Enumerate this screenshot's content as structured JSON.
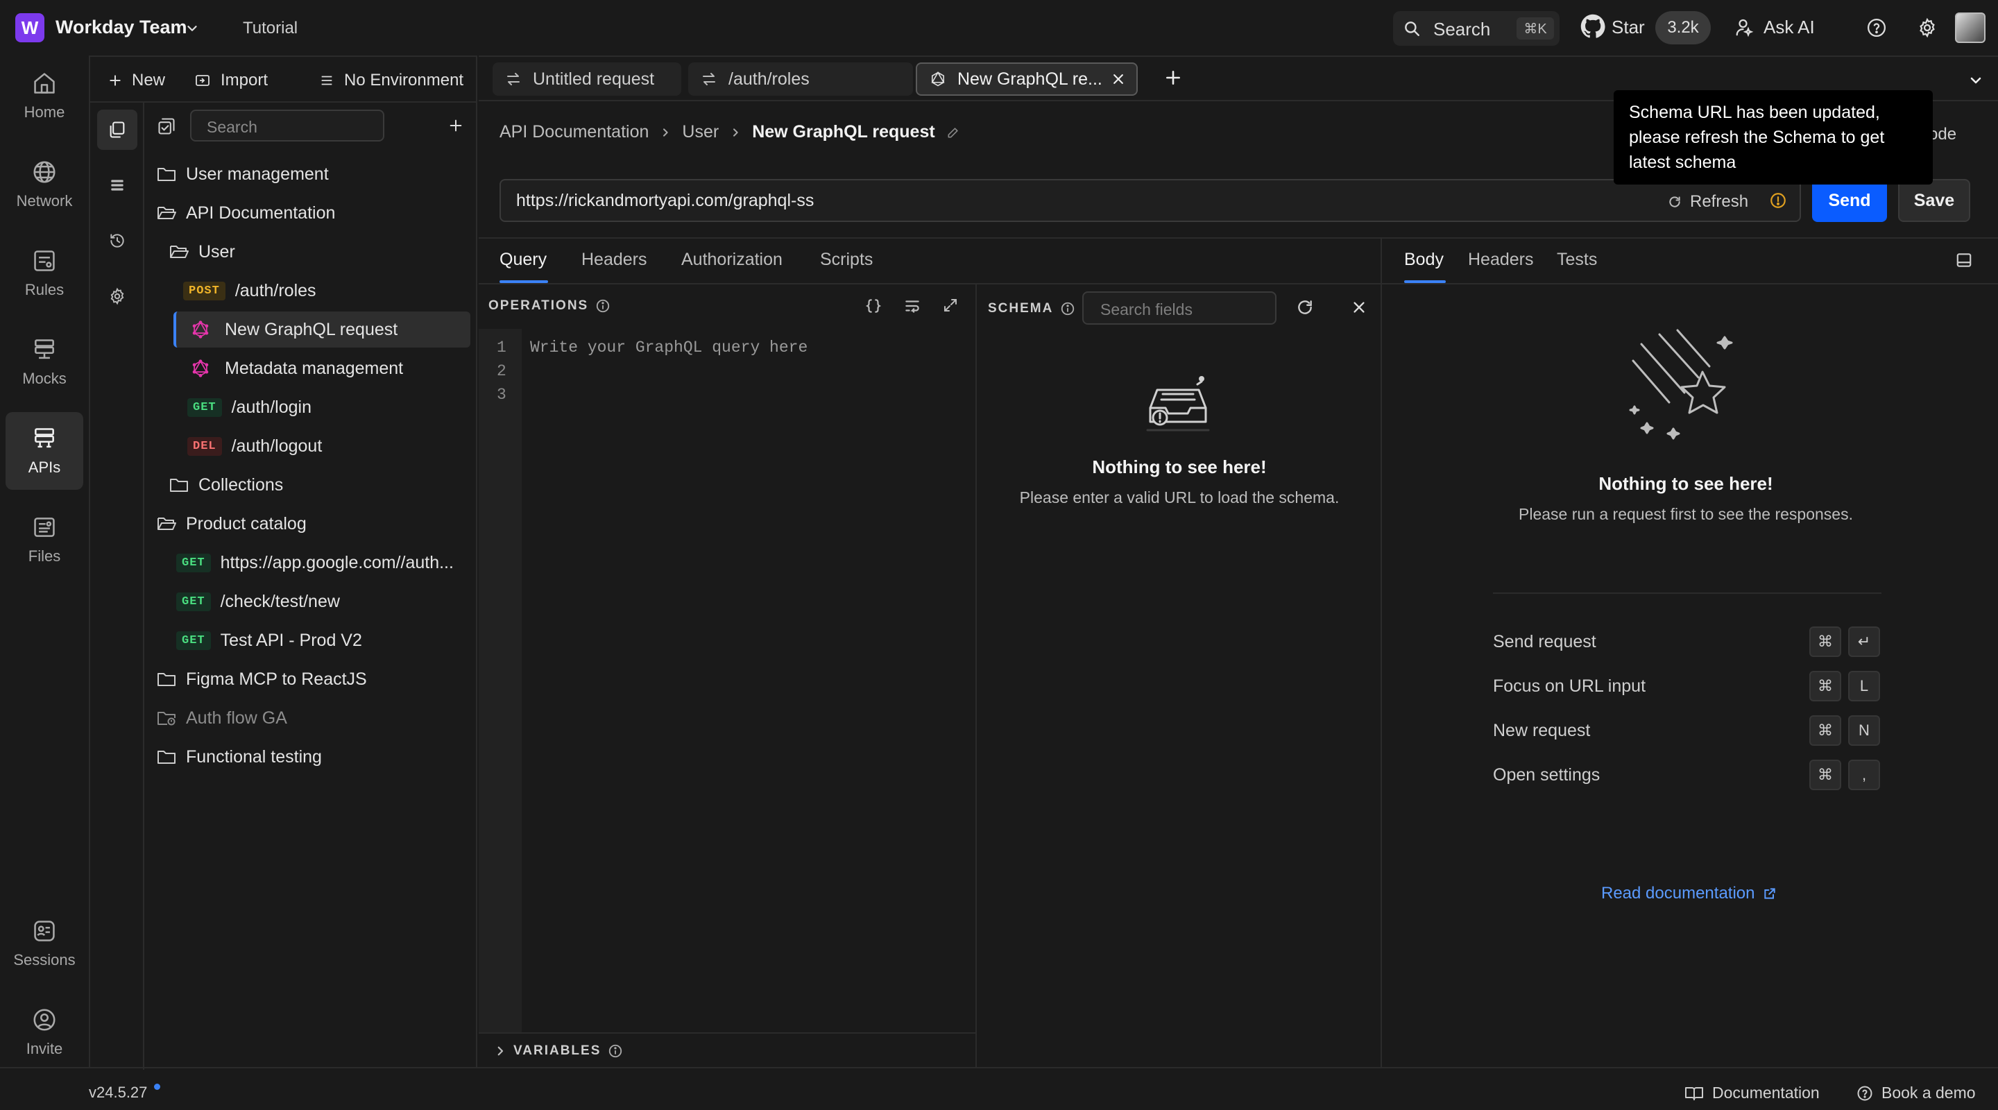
{
  "app": {
    "workspace_initial": "W",
    "workspace_name": "Workday Team",
    "tutorial_label": "Tutorial",
    "accent": "#7c3aed"
  },
  "topbar": {
    "search_label": "Search",
    "search_shortcut": "⌘K",
    "star_label": "Star",
    "star_count": "3.2k",
    "ask_ai_label": "Ask AI"
  },
  "rail": {
    "items": [
      {
        "label": "Home",
        "icon": "home-icon"
      },
      {
        "label": "Network",
        "icon": "globe-icon"
      },
      {
        "label": "Rules",
        "icon": "rules-icon"
      },
      {
        "label": "Mocks",
        "icon": "mocks-icon"
      },
      {
        "label": "APIs",
        "icon": "apis-icon",
        "active": true
      },
      {
        "label": "Files",
        "icon": "files-icon"
      }
    ],
    "bottom": [
      {
        "label": "Sessions",
        "icon": "sessions-icon"
      },
      {
        "label": "Invite",
        "icon": "invite-icon"
      }
    ]
  },
  "sidebar": {
    "new_label": "New",
    "import_label": "Import",
    "environment_label": "No Environment",
    "search_placeholder": "Search",
    "tree": [
      {
        "label": "User management",
        "type": "folder"
      },
      {
        "label": "API Documentation",
        "type": "folder-open"
      },
      {
        "label": "User",
        "type": "folder-open"
      },
      {
        "label": "/auth/roles",
        "method": "POST"
      },
      {
        "label": "New GraphQL request",
        "type": "graphql",
        "selected": true
      },
      {
        "label": "Metadata management",
        "type": "graphql"
      },
      {
        "label": "/auth/login",
        "method": "GET"
      },
      {
        "label": "/auth/logout",
        "method": "DEL"
      },
      {
        "label": "Collections",
        "type": "folder"
      },
      {
        "label": "Product catalog",
        "type": "folder-open"
      },
      {
        "label": "https://app.google.com//auth...",
        "method": "GET"
      },
      {
        "label": "/check/test/new",
        "method": "GET"
      },
      {
        "label": "Test API - Prod V2",
        "method": "GET"
      },
      {
        "label": "Figma MCP to ReactJS",
        "type": "folder"
      },
      {
        "label": "Auth flow GA",
        "type": "folder-locked"
      },
      {
        "label": "Functional testing",
        "type": "folder"
      }
    ]
  },
  "tabs": [
    {
      "label": "Untitled request",
      "icon": "swap-icon"
    },
    {
      "label": "/auth/roles",
      "icon": "swap-icon"
    },
    {
      "label": "New GraphQL re...",
      "icon": "graphql-icon",
      "active": true
    }
  ],
  "request": {
    "breadcrumb": [
      "API Documentation",
      "User",
      "New GraphQL request"
    ],
    "url": "https://rickandmortyapi.com/graphql-ss",
    "refresh_label": "Refresh",
    "send_label": "Send",
    "save_label": "Save",
    "code_label_partial": "ode"
  },
  "tooltip": {
    "text": "Schema URL has been updated, please refresh the Schema to get latest schema"
  },
  "query_tabs": [
    "Query",
    "Headers",
    "Authorization",
    "Scripts"
  ],
  "operations": {
    "label": "OPERATIONS",
    "line_numbers": [
      "1",
      "2",
      "3"
    ],
    "placeholder": "Write your GraphQL query here",
    "variables_label": "VARIABLES"
  },
  "schema": {
    "label": "SCHEMA",
    "search_placeholder": "Search fields",
    "empty_title": "Nothing to see here!",
    "empty_sub": "Please enter a valid URL to load the schema."
  },
  "response": {
    "tabs": [
      "Body",
      "Headers",
      "Tests"
    ],
    "empty_title": "Nothing to see here!",
    "empty_sub": "Please run a request first to see the responses.",
    "shortcuts": [
      {
        "label": "Send request",
        "keys": [
          "⌘",
          "↵"
        ]
      },
      {
        "label": "Focus on URL input",
        "keys": [
          "⌘",
          "L"
        ]
      },
      {
        "label": "New request",
        "keys": [
          "⌘",
          "N"
        ]
      },
      {
        "label": "Open settings",
        "keys": [
          "⌘",
          ","
        ]
      }
    ],
    "read_docs_label": "Read documentation"
  },
  "footer": {
    "version": "v24.5.27",
    "documentation_label": "Documentation",
    "book_demo_label": "Book a demo"
  }
}
